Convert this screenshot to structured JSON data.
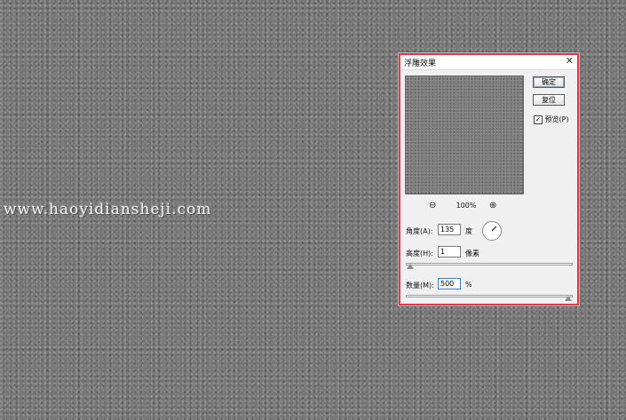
{
  "watermark": "www.haoyidiansheji.com",
  "dialog": {
    "title": "浮雕效果",
    "close_glyph": "✕",
    "buttons": {
      "ok": "确定",
      "reset": "复位"
    },
    "preview_checkbox": {
      "label": "预览(P)",
      "checked": true,
      "check_glyph": "✓"
    },
    "zoom": {
      "level": "100%",
      "zoom_out_glyph": "⊖",
      "zoom_in_glyph": "⊕"
    },
    "angle": {
      "label": "角度(A):",
      "value": "135",
      "unit": "度",
      "degrees": 135
    },
    "height": {
      "label": "高度(H):",
      "value": "1",
      "unit": "像素",
      "slider_fraction": 0.0
    },
    "amount": {
      "label": "数量(M):",
      "value": "500",
      "unit": "%",
      "slider_fraction": 1.0
    }
  },
  "colors": {
    "dialog_border": "#e23a4a",
    "focus_border": "#3c7fd0",
    "canvas_gray": "#777777"
  }
}
